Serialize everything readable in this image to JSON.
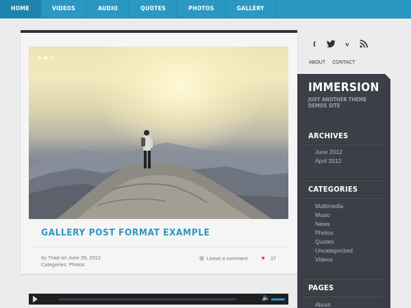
{
  "nav": {
    "items": [
      {
        "label": "HOME",
        "active": true
      },
      {
        "label": "VIDEOS"
      },
      {
        "label": "AUDIO"
      },
      {
        "label": "QUOTES"
      },
      {
        "label": "PHOTOS"
      },
      {
        "label": "GALLERY"
      }
    ]
  },
  "post": {
    "title": "GALLERY POST FORMAT EXAMPLE",
    "meta_by": "by",
    "author": "Thad",
    "meta_on": "on",
    "date": "June 29, 2012",
    "categories_label": "Categories:",
    "category": "Photos",
    "comment_label": "Leave a comment",
    "likes": "37"
  },
  "header_links": [
    "ABOUT",
    "CONTACT"
  ],
  "social": [
    "facebook-icon",
    "twitter-icon",
    "vimeo-icon",
    "rss-icon"
  ],
  "site": {
    "title": "IMMERSION",
    "tagline": "JUST ANOTHER THEME DEMOS SITE"
  },
  "widgets": {
    "archives": {
      "title": "ARCHIVES",
      "items": [
        "June 2012",
        "April 2012"
      ]
    },
    "categories": {
      "title": "CATEGORIES",
      "items": [
        "Multimedia",
        "Music",
        "News",
        "Photos",
        "Quotes",
        "Uncategorized",
        "Videos"
      ]
    },
    "pages": {
      "title": "PAGES",
      "items": [
        "About"
      ]
    }
  },
  "colors": {
    "accent": "#2b97c3",
    "sidebar": "#3c4046",
    "heart": "#e23a3a"
  }
}
